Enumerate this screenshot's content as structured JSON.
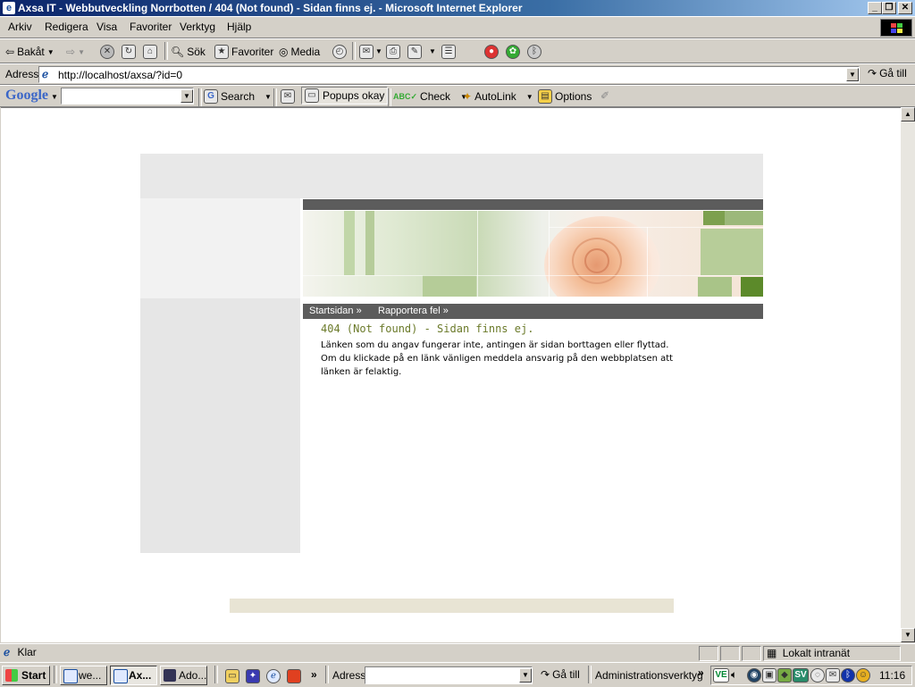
{
  "window": {
    "title": "Axsa IT - Webbutveckling Norrbotten / 404 (Not found) - Sidan finns ej. - Microsoft Internet Explorer"
  },
  "menu": [
    "Arkiv",
    "Redigera",
    "Visa",
    "Favoriter",
    "Verktyg",
    "Hjälp"
  ],
  "toolbar": {
    "back": "Bakåt",
    "search": "Sök",
    "favorites": "Favoriter",
    "media": "Media"
  },
  "address": {
    "label": "Adress",
    "url": "http://localhost/axsa/?id=0",
    "go": "Gå till"
  },
  "google": {
    "logo": "Google",
    "search": "Search",
    "popups": "Popups okay",
    "check": "Check",
    "autolink": "AutoLink",
    "options": "Options"
  },
  "page": {
    "nav": [
      "Startsidan",
      "Rapportera fel"
    ],
    "nav_arrow": "»",
    "heading": "404 (Not found) - Sidan finns ej.",
    "line1": "Länken som du angav fungerar inte, antingen är sidan borttagen eller flyttad.",
    "line2": "Om du klickade på en länk vänligen meddela ansvarig på den webbplatsen att",
    "line3": "länken är felaktig.",
    "colors": {
      "heading": "#6b7a2a",
      "nav_bar": "#5c5c5c",
      "panel": "#e8e8e8",
      "footer": "#e8e4d4",
      "rose": "#f2b890",
      "leaf": "#9cb87a"
    }
  },
  "status": {
    "text": "Klar",
    "zone": "Lokalt intranät"
  },
  "taskbar": {
    "start": "Start",
    "buttons": [
      "we...",
      "Ax...",
      "Ado..."
    ],
    "address_label": "Adress",
    "go": "Gå till",
    "tools": "Administrationsverktyg",
    "chevron": "»",
    "tray_ve": "VE",
    "tray_sv": "SV",
    "clock": "11:16"
  }
}
